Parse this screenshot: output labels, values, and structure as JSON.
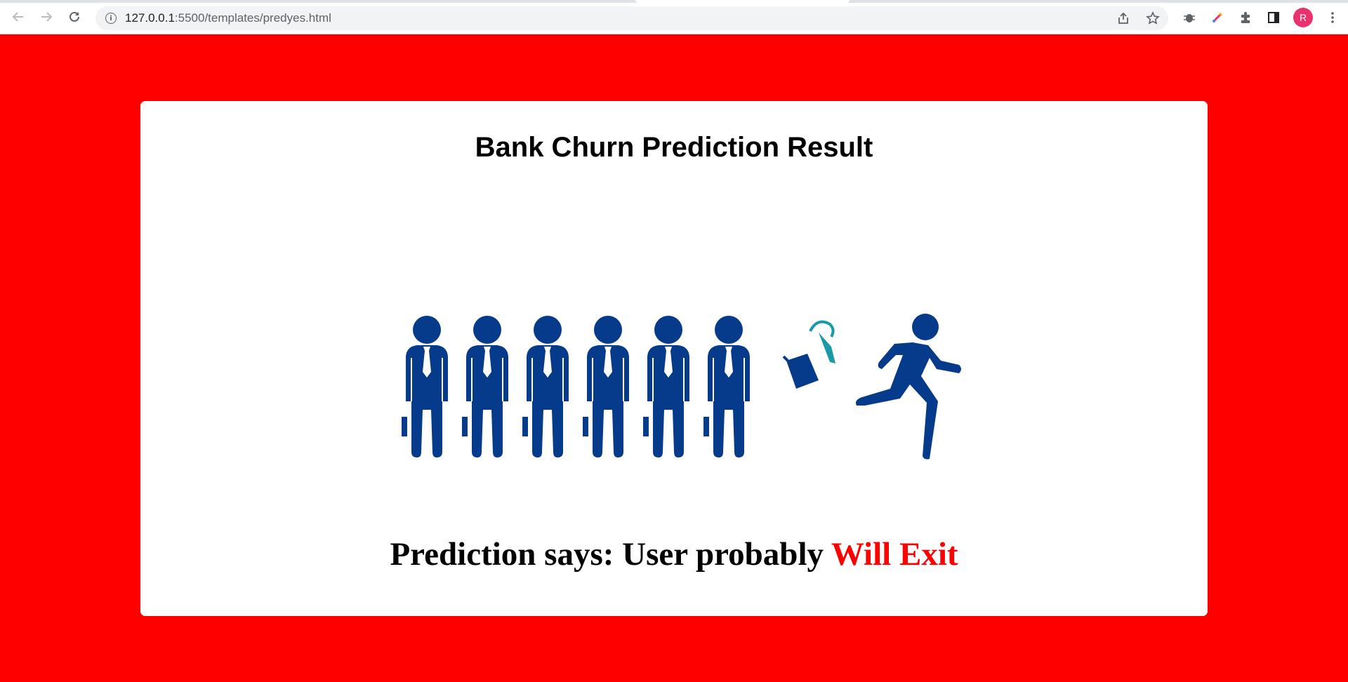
{
  "browser": {
    "url_host": "127.0.0.1",
    "url_rest": ":5500/templates/predyes.html",
    "profile_initial": "R"
  },
  "page": {
    "title": "Bank Churn Prediction Result",
    "result_prefix": "Prediction says: User probably ",
    "result_highlight": "Will Exit"
  },
  "colors": {
    "background": "#ff0000",
    "card": "#ffffff",
    "figure": "#063b8c",
    "highlight": "#ff0000"
  }
}
